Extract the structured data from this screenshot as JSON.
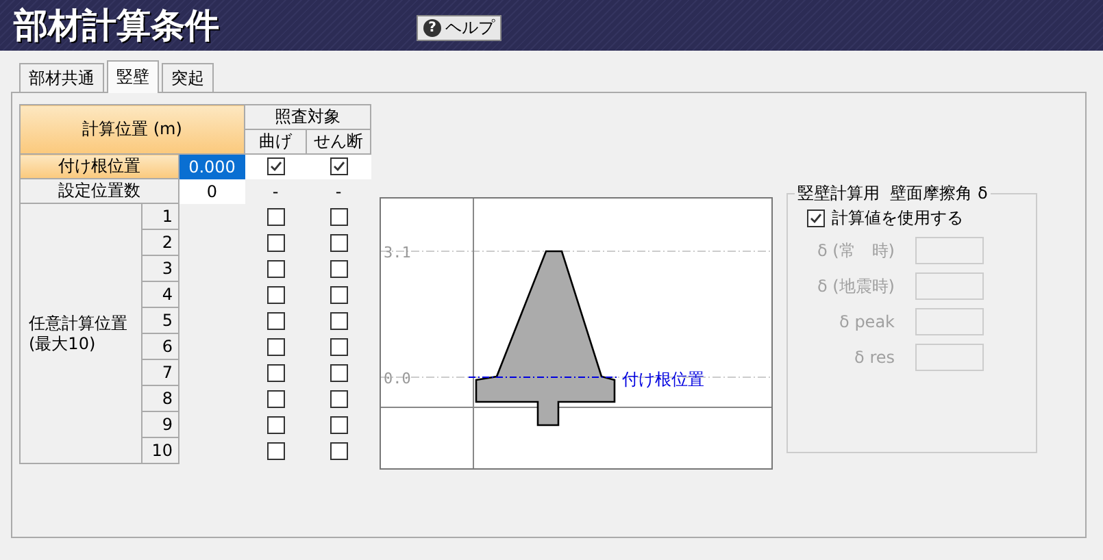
{
  "window": {
    "title": "部材計算条件"
  },
  "help_button": {
    "icon": "?",
    "label": "ヘルプ"
  },
  "tabs": [
    {
      "label": "部材共通",
      "selected": false
    },
    {
      "label": "竪壁",
      "selected": true
    },
    {
      "label": "突起",
      "selected": false
    }
  ],
  "table": {
    "header": {
      "position": "計算位置 (m)",
      "target": "照査対象",
      "bending": "曲げ",
      "shear": "せん断"
    },
    "base_row": {
      "label": "付け根位置",
      "value": "0.000",
      "selected": true,
      "bending": true,
      "shear": true
    },
    "count_row": {
      "label": "設定位置数",
      "value": "0",
      "bending": "-",
      "shear": "-"
    },
    "arbitrary": {
      "label": "任意計算位置\n(最大10)",
      "rows": [
        {
          "number": "1",
          "bending": false,
          "shear": false
        },
        {
          "number": "2",
          "bending": false,
          "shear": false
        },
        {
          "number": "3",
          "bending": false,
          "shear": false
        },
        {
          "number": "4",
          "bending": false,
          "shear": false
        },
        {
          "number": "5",
          "bending": false,
          "shear": false
        },
        {
          "number": "6",
          "bending": false,
          "shear": false
        },
        {
          "number": "7",
          "bending": false,
          "shear": false
        },
        {
          "number": "8",
          "bending": false,
          "shear": false
        },
        {
          "number": "9",
          "bending": false,
          "shear": false
        },
        {
          "number": "10",
          "bending": false,
          "shear": false
        }
      ]
    }
  },
  "diagram": {
    "ticks": [
      "3.1",
      "0.0"
    ],
    "base_label": "付け根位置"
  },
  "friction_group": {
    "title": "竪壁計算用  壁面摩擦角 δ",
    "use_calculated": {
      "label": "計算値を使用する",
      "checked": true
    },
    "fields": [
      {
        "label": "δ (常　時)",
        "disabled": true
      },
      {
        "label": "δ (地震時)",
        "disabled": true
      },
      {
        "label": "δ peak",
        "disabled": true
      },
      {
        "label": "δ res",
        "disabled": true
      }
    ]
  }
}
